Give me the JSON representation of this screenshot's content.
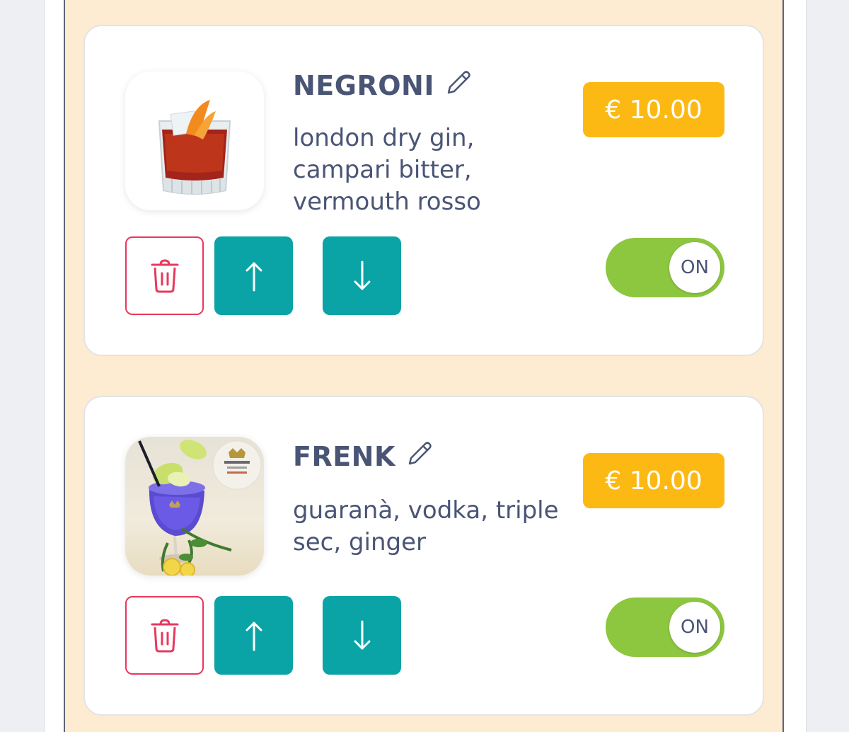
{
  "items": [
    {
      "name": "NEGRONI",
      "description": "london dry gin, campari bitter, vermouth rosso",
      "price": "€ 10.00",
      "toggle_label": "ON",
      "enabled": true,
      "image_icon": "negroni-cocktail-image"
    },
    {
      "name": "FRENK",
      "description": "guaranà, vodka, triple sec, ginger",
      "price": "€ 10.00",
      "toggle_label": "ON",
      "enabled": true,
      "image_icon": "frenk-cocktail-image"
    }
  ],
  "icons": {
    "edit": "pencil-icon",
    "delete": "trash-icon",
    "move_up": "arrow-up-icon",
    "move_down": "arrow-down-icon"
  },
  "colors": {
    "price_badge": "#fdb913",
    "toggle_on": "#8dc63f",
    "move_button": "#0aa3a6",
    "delete_border": "#e8385e",
    "text": "#4a5576",
    "panel_background": "#fdebd2"
  }
}
